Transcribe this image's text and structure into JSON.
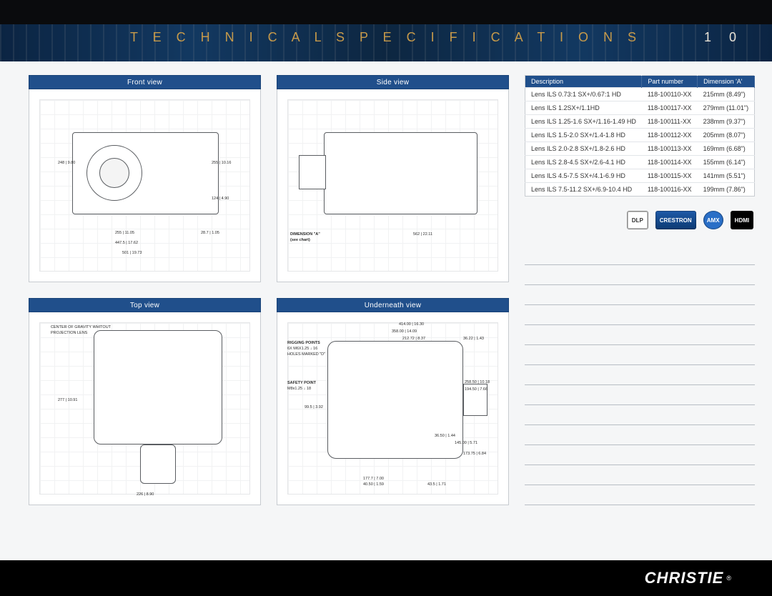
{
  "header": {
    "title": "T E C H N I C A L   S P E C I F I C A T I O N S",
    "page_number": "1 0"
  },
  "panels": {
    "front": {
      "title": "Front view",
      "dims": [
        "248 | 9.80",
        "255 | 10.16",
        "124 | 4.90",
        "255 | 11.05",
        "28.7 | 1.05",
        "447.5 | 17.62",
        "501 | 19.73"
      ]
    },
    "side": {
      "title": "Side view",
      "dims": [
        "562 | 22.11",
        "DIMENSION \"A\"",
        "(see chart)"
      ]
    },
    "top": {
      "title": "Top view",
      "dims": [
        "CENTER OF GRAVITY WHITOUT",
        "PROJECTION LENS",
        "277 | 10.91",
        "226 | 8.90"
      ]
    },
    "underneath": {
      "title": "Underneath view",
      "dims": [
        "414.00 | 16.30",
        "358.00 | 14.09",
        "212.72 | 8.37",
        "36.22 | 1.43",
        "RIGGING POINTS",
        "6X M6X1.25 ↓ 16",
        "HOLES MARKED \"D\"",
        "SAFETY POINT",
        "M8x1.25 ↓ 18",
        "99.5 | 3.92",
        "258.50 | 10.18",
        "194.50 | 7.66",
        "36.50 | 1.44",
        "145.00 | 5.71",
        "173.75 | 6.84",
        "177.7 | 7.00",
        "40.50 | 1.59",
        "43.5 | 1.71"
      ]
    }
  },
  "lens_table": {
    "headers": [
      "Description",
      "Part number",
      "Dimension 'A'"
    ],
    "rows": [
      {
        "desc": "Lens ILS 0.73:1 SX+/0.67:1 HD",
        "part": "118-100110-XX",
        "dim": "215mm (8.49\")"
      },
      {
        "desc": "Lens ILS 1.2SX+/1.1HD",
        "part": "118-100117-XX",
        "dim": "279mm (11.01\")"
      },
      {
        "desc": "Lens ILS 1.25-1.6 SX+/1.16-1.49 HD",
        "part": "118-100111-XX",
        "dim": "238mm (9.37\")"
      },
      {
        "desc": "Lens ILS 1.5-2.0 SX+/1.4-1.8 HD",
        "part": "118-100112-XX",
        "dim": "205mm (8.07\")"
      },
      {
        "desc": "Lens ILS 2.0-2.8 SX+/1.8-2.6 HD",
        "part": "118-100113-XX",
        "dim": "169mm (6.68\")"
      },
      {
        "desc": "Lens ILS 2.8-4.5 SX+/2.6-4.1 HD",
        "part": "118-100114-XX",
        "dim": "155mm (6.14\")"
      },
      {
        "desc": "Lens ILS 4.5-7.5 SX+/4.1-6.9 HD",
        "part": "118-100115-XX",
        "dim": "141mm (5.51\")"
      },
      {
        "desc": "Lens ILS 7.5-11.2 SX+/6.9-10.4 HD",
        "part": "118-100116-XX",
        "dim": "199mm (7.86\")"
      }
    ]
  },
  "logos": {
    "dlp": "DLP",
    "crestron": "CRESTRON",
    "amx": "AMX",
    "hdmi": "HDMI"
  },
  "footer": {
    "brand": "CHRISTIE",
    "reg": "®"
  }
}
